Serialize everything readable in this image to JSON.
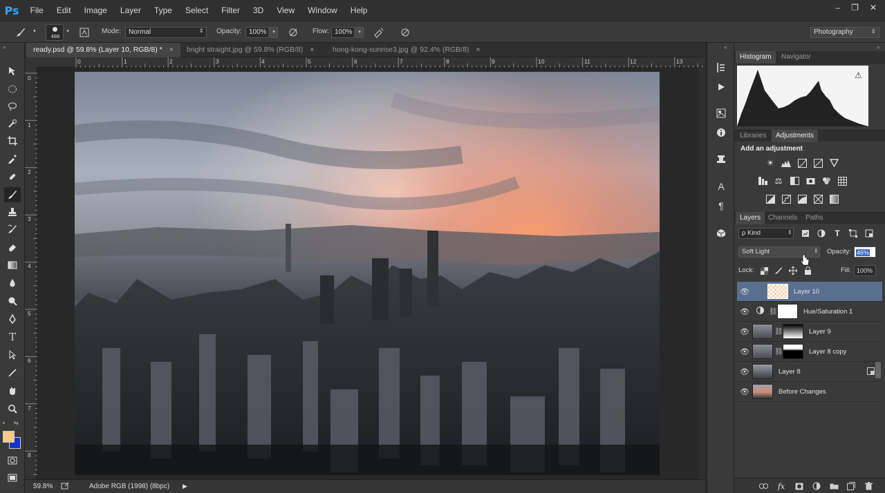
{
  "menubar": {
    "logo": "Ps",
    "items": [
      "File",
      "Edit",
      "Image",
      "Layer",
      "Type",
      "Select",
      "Filter",
      "3D",
      "View",
      "Window",
      "Help"
    ],
    "window_controls": [
      "–",
      "❐",
      "✕"
    ]
  },
  "options": {
    "brush_size": "486",
    "mode_label": "Mode:",
    "mode_value": "Normal",
    "opacity_label": "Opacity:",
    "opacity_value": "100%",
    "flow_label": "Flow:",
    "flow_value": "100%",
    "workspace": "Photography"
  },
  "tabs": [
    {
      "label": "ready.psd @ 59.8% (Layer 10, RGB/8) *",
      "close": "×"
    },
    {
      "label": "bright straight.jpg @ 59.8% (RGB/8)",
      "close": "×"
    },
    {
      "label": "hong-kong-sunrise3.jpg @ 92.4% (RGB/8)",
      "close": "×"
    }
  ],
  "ruler": {
    "h": [
      "0",
      "1",
      "2",
      "3",
      "4",
      "5",
      "6",
      "7",
      "8",
      "9",
      "10",
      "11",
      "12",
      "13"
    ],
    "v": [
      "0",
      "1",
      "2",
      "3",
      "4",
      "5",
      "6",
      "7",
      "8"
    ]
  },
  "status": {
    "zoom": "59.8%",
    "profile": "Adobe RGB (1998) (8bpc)",
    "arrow": "▶"
  },
  "panels": {
    "histogram_tab": "Histogram",
    "navigator_tab": "Navigator",
    "warning": "⚠",
    "libraries_tab": "Libraries",
    "adjustments_tab": "Adjustments",
    "add_adjustment": "Add an adjustment",
    "layers_tab": "Layers",
    "channels_tab": "Channels",
    "paths_tab": "Paths",
    "kind_label": "ρ Kind",
    "blend_mode": "Soft Light",
    "opacity_label": "Opacity:",
    "opacity_value": "46%",
    "lock_label": "Lock:",
    "fill_label": "Fill:",
    "fill_value": "100%"
  },
  "layers": [
    {
      "name": "Layer 10"
    },
    {
      "name": "Hue/Saturation 1"
    },
    {
      "name": "Layer 9"
    },
    {
      "name": "Layer 8 copy"
    },
    {
      "name": "Layer 8"
    },
    {
      "name": "Before Changes"
    }
  ],
  "colors": {
    "foreground": "#f5c98a",
    "background": "#1733c8",
    "selected_layer": "#596f8f",
    "ps_blue": "#31a8ff"
  }
}
